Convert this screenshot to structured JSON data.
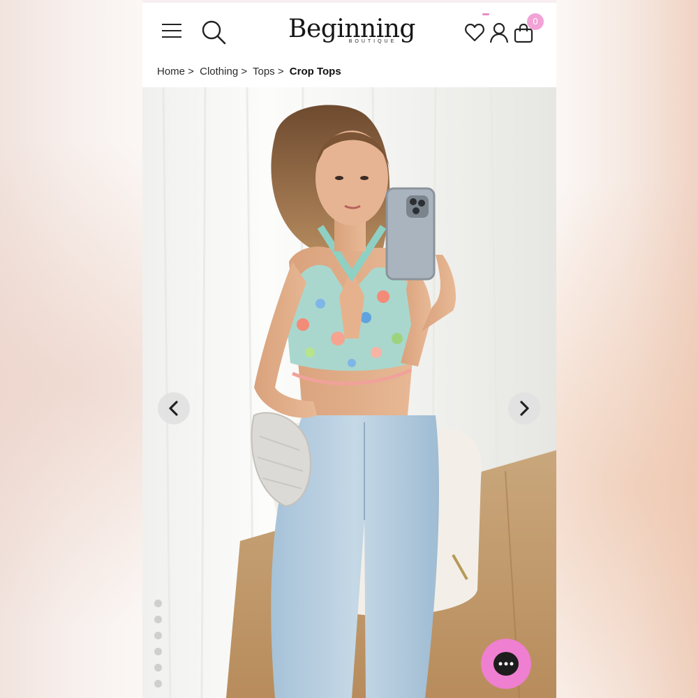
{
  "brand": {
    "logo_text": "Beginning",
    "logo_subtext": "BOUTIQUE",
    "accent_color": "#ef7fd0"
  },
  "header": {
    "icons": [
      "menu-icon",
      "search-icon",
      "heart-icon",
      "user-icon",
      "bag-icon"
    ],
    "cart_count": "0"
  },
  "breadcrumb": {
    "items": [
      "Home >",
      "Clothing >",
      "Tops >"
    ],
    "current": "Crop Tops"
  },
  "gallery": {
    "image": "model-photo",
    "prev_icon": "chevron-left-icon",
    "next_icon": "chevron-right-icon",
    "dots": 6
  },
  "chat": {
    "icon": "chat-icon"
  }
}
